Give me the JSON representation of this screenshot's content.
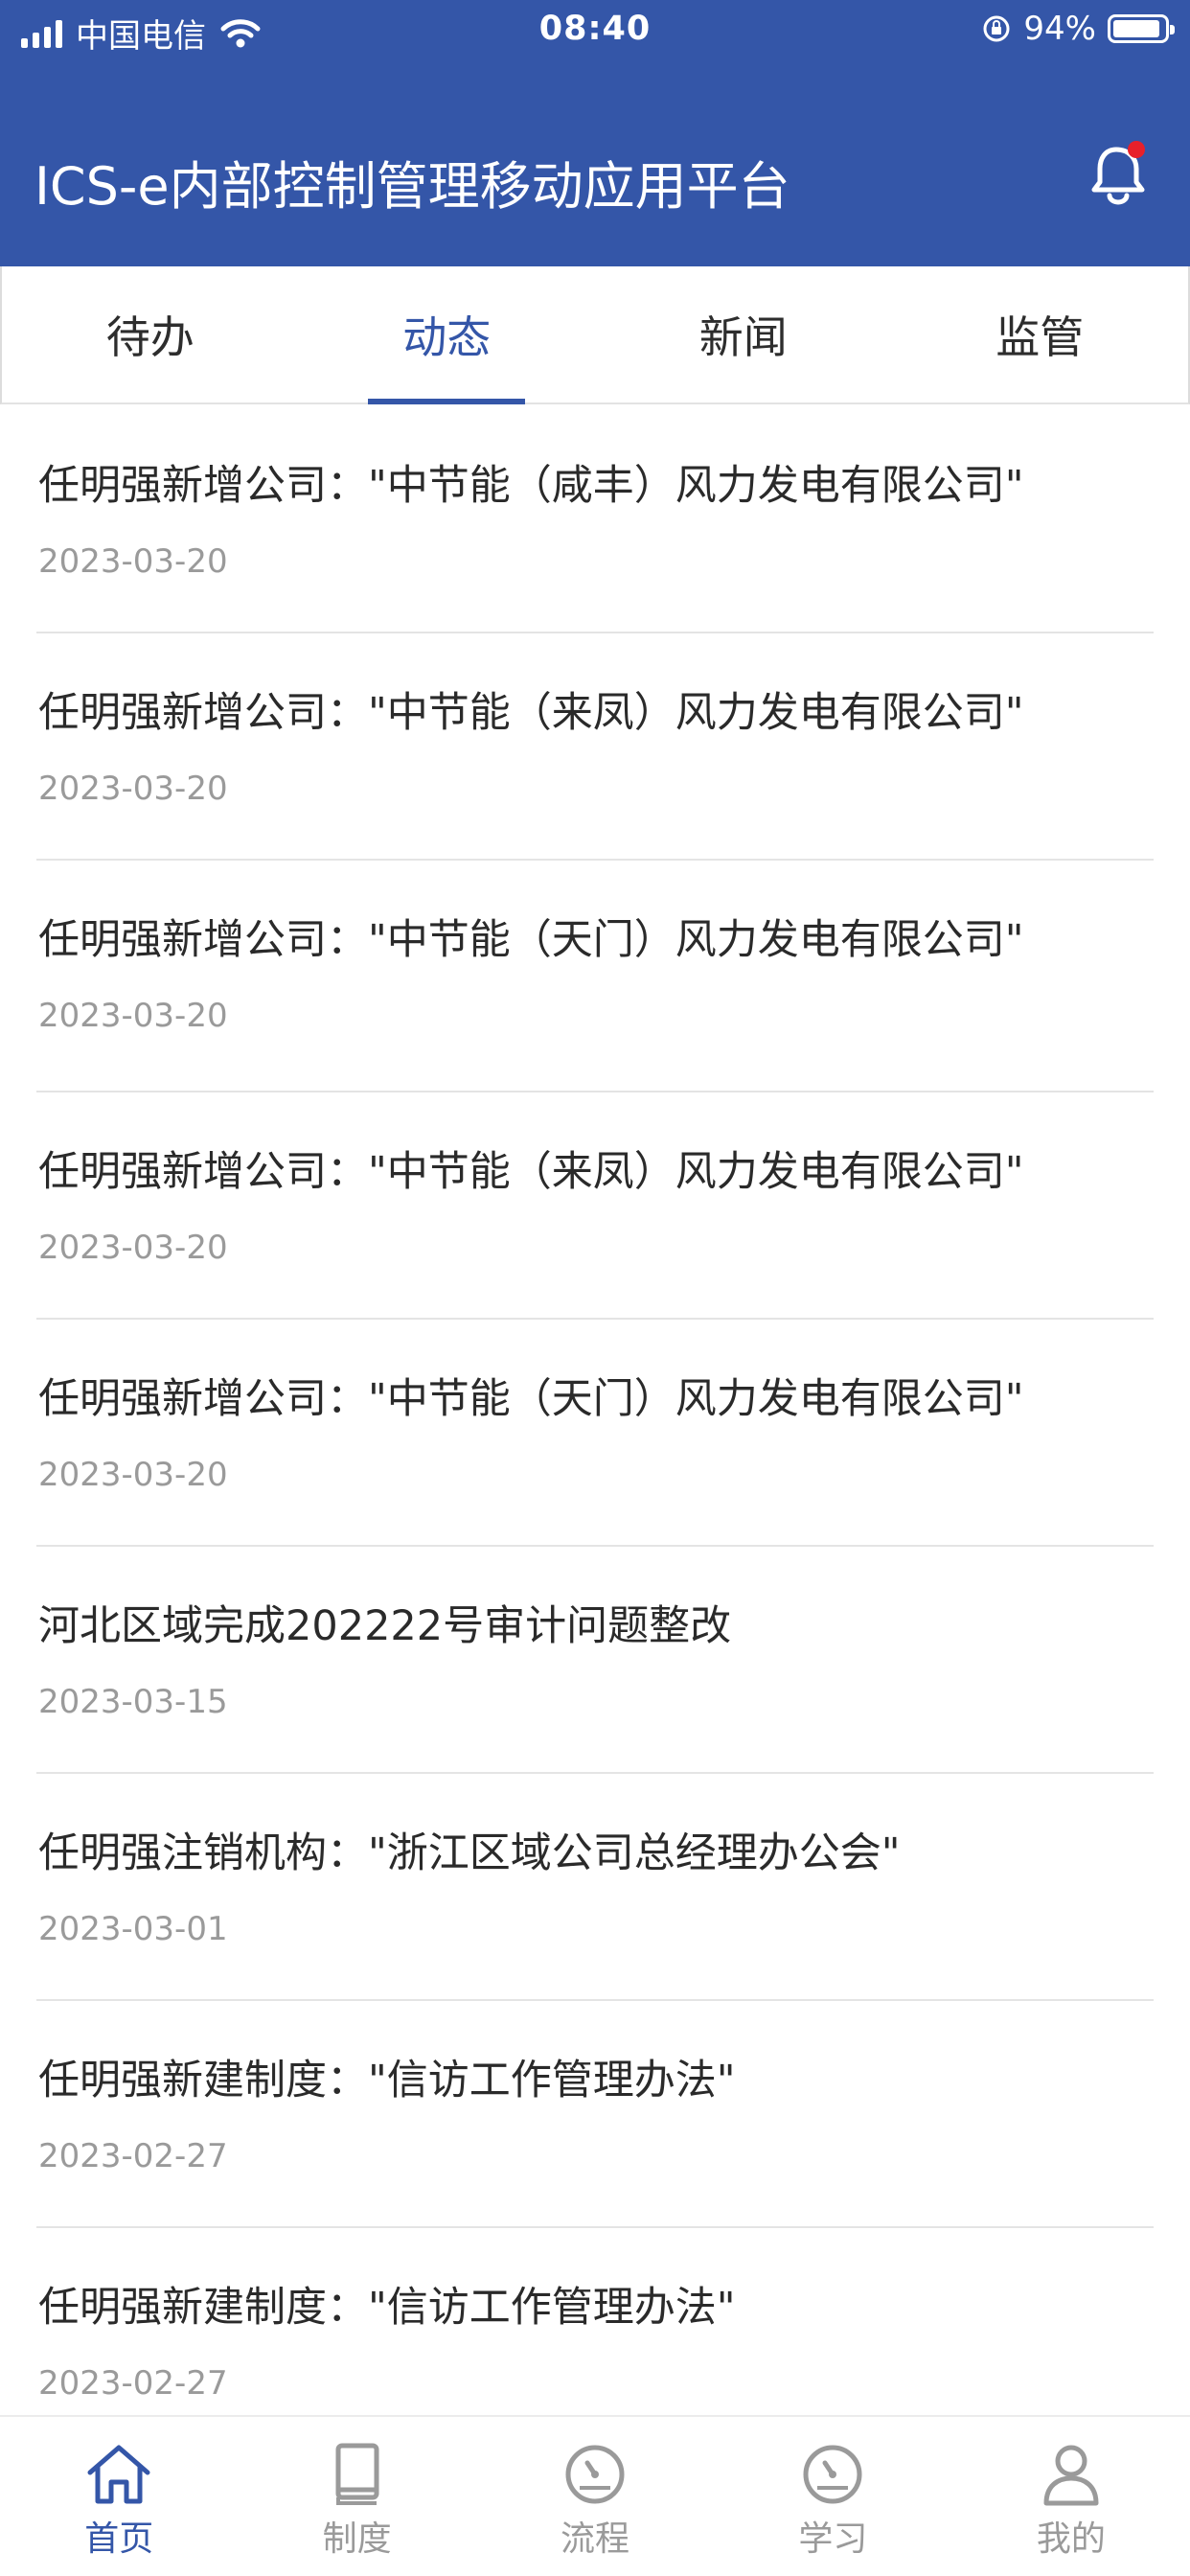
{
  "status_bar": {
    "carrier": "中国电信",
    "time": "08:40",
    "battery": "94%"
  },
  "header": {
    "title": "ICS-e内部控制管理移动应用平台"
  },
  "tabs": [
    {
      "label": "待办"
    },
    {
      "label": "动态"
    },
    {
      "label": "新闻"
    },
    {
      "label": "监管"
    }
  ],
  "feed": [
    {
      "title": "任明强新增公司：\"中节能（咸丰）风力发电有限公司\"",
      "date": "2023-03-20"
    },
    {
      "title": "任明强新增公司：\"中节能（来凤）风力发电有限公司\"",
      "date": "2023-03-20"
    },
    {
      "title": "任明强新增公司：\"中节能（天门）风力发电有限公司\"",
      "date": "2023-03-20"
    },
    {
      "title": "任明强新增公司：\"中节能（来凤）风力发电有限公司\"",
      "date": "2023-03-20"
    },
    {
      "title": "任明强新增公司：\"中节能（天门）风力发电有限公司\"",
      "date": "2023-03-20"
    },
    {
      "title": "河北区域完成202222号审计问题整改",
      "date": "2023-03-15"
    },
    {
      "title": "任明强注销机构：\"浙江区域公司总经理办公会\"",
      "date": "2023-03-01"
    },
    {
      "title": "任明强新建制度：\"信访工作管理办法\"",
      "date": "2023-02-27"
    },
    {
      "title": "任明强新建制度：\"信访工作管理办法\"",
      "date": "2023-02-27"
    }
  ],
  "bottom_nav": [
    {
      "label": "首页",
      "icon": "home-icon"
    },
    {
      "label": "制度",
      "icon": "book-icon"
    },
    {
      "label": "流程",
      "icon": "gauge-icon"
    },
    {
      "label": "学习",
      "icon": "gauge-icon"
    },
    {
      "label": "我的",
      "icon": "user-icon"
    }
  ],
  "colors": {
    "primary": "#3456a8",
    "notification_dot": "#e8202a"
  }
}
